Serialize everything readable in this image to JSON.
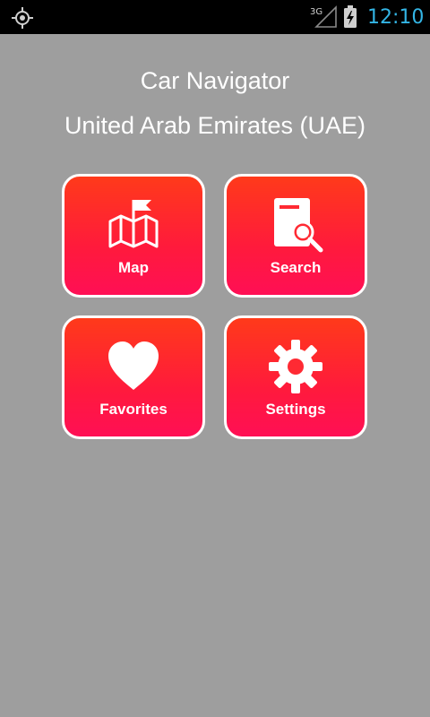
{
  "status_bar": {
    "time": "12:10",
    "network_label": "3G",
    "icons": [
      "gps-icon",
      "signal-icon",
      "battery-charging-icon"
    ],
    "clock_color": "#33b5e5"
  },
  "header": {
    "title": "Car Navigator",
    "subtitle": "United Arab Emirates (UAE)"
  },
  "menu": {
    "items": [
      {
        "label": "Map",
        "icon": "map-flag-icon"
      },
      {
        "label": "Search",
        "icon": "search-book-icon"
      },
      {
        "label": "Favorites",
        "icon": "heart-icon"
      },
      {
        "label": "Settings",
        "icon": "gear-icon"
      }
    ]
  },
  "colors": {
    "background": "#9e9e9e",
    "tile_top": "#ff3a1a",
    "tile_bottom": "#ff0f55",
    "tile_border": "#ffffff"
  }
}
